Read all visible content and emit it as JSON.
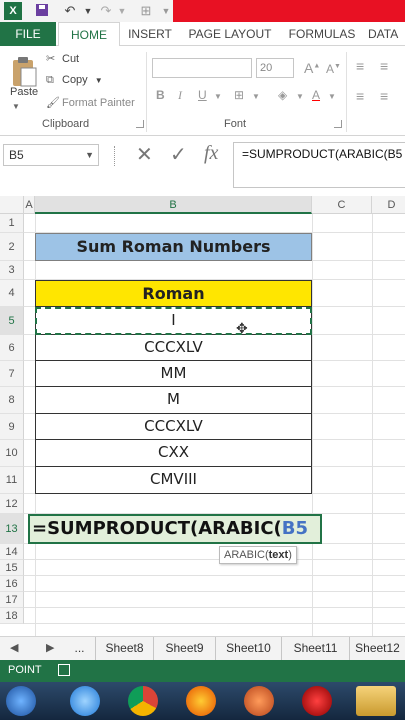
{
  "ribbon": {
    "tabs": [
      "FILE",
      "HOME",
      "INSERT",
      "PAGE LAYOUT",
      "FORMULAS",
      "DATA"
    ],
    "paste_label": "Paste",
    "cut_label": "Cut",
    "copy_label": "Copy",
    "format_painter_label": "Format Painter",
    "clipboard_group": "Clipboard",
    "font_group": "Font",
    "font_size": "20"
  },
  "formula_bar": {
    "name_box": "B5",
    "cancel_symbol": "✕",
    "enter_symbol": "✓",
    "fx_symbol": "fx",
    "content": "=SUMPRODUCT(ARABIC(B5"
  },
  "grid": {
    "columns": [
      "A",
      "B",
      "C",
      "D"
    ],
    "rows": [
      "1",
      "2",
      "3",
      "4",
      "5",
      "6",
      "7",
      "8",
      "9",
      "10",
      "11",
      "12",
      "13",
      "14",
      "15",
      "16",
      "17",
      "18"
    ],
    "title": "Sum Roman Numbers",
    "header": "Roman",
    "values": [
      "I",
      "CCCXLV",
      "MM",
      "M",
      "CCCXLV",
      "CXX",
      "CMVIII"
    ],
    "formula_text": "=SUMPRODUCT(ARABIC(",
    "formula_ref": "B5",
    "tooltip_fn": "ARABIC(",
    "tooltip_arg": "text",
    "tooltip_close": ")"
  },
  "sheets": {
    "ellipsis": "...",
    "tabs": [
      "Sheet8",
      "Sheet9",
      "Sheet10",
      "Sheet11",
      "Sheet12"
    ]
  },
  "status": {
    "mode": "POINT"
  },
  "colors": {
    "excel_green": "#217346",
    "title_fill": "#9dc3e6",
    "header_fill": "#ffe600",
    "formula_fill": "#e2efda"
  }
}
